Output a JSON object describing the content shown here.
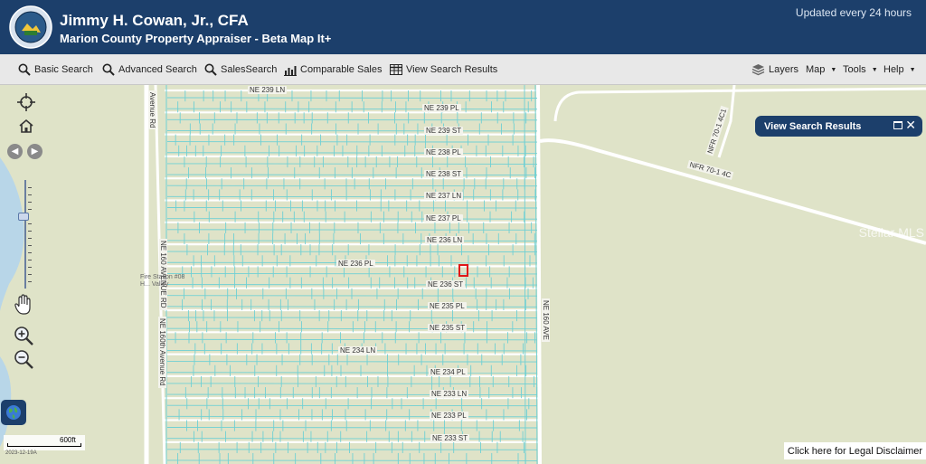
{
  "header": {
    "name": "Jimmy H. Cowan, Jr., CFA",
    "subtitle": "Marion County Property Appraiser - Beta Map It+",
    "updated": "Updated every 24 hours"
  },
  "toolbar": {
    "basic_search": "Basic Search",
    "advanced_search": "Advanced Search",
    "sales_search": "SalesSearch",
    "comparable_sales": "Comparable Sales",
    "view_search_results": "View Search Results",
    "layers": "Layers",
    "map": "Map",
    "tools": "Tools",
    "help": "Help"
  },
  "panel": {
    "title": "View Search Results"
  },
  "streets": {
    "ne239ln": "NE 239 LN",
    "ne239pl": "NE 239 PL",
    "ne239st": "NE 239 ST",
    "ne238pl": "NE 238 PL",
    "ne238st": "NE 238 ST",
    "ne237ln": "NE 237 LN",
    "ne237pl": "NE 237 PL",
    "ne236ln": "NE 236 LN",
    "ne236pl": "NE 236 PL",
    "ne236st": "NE 236 ST",
    "ne235pl": "NE 235 PL",
    "ne235st": "NE 235 ST",
    "ne234ln": "NE 234 LN",
    "ne234pl": "NE 234 PL",
    "ne233ln": "NE 233 LN",
    "ne233pl": "NE 233 PL",
    "ne233st": "NE 233 ST",
    "avenue_rd": "Avenue Rd",
    "ne160_avenue_rd": "NE 160 AVENUE RD",
    "ne160th_avenue_rd": "NE 160th Avenue Rd",
    "ne160_ave": "NE 160 AVE",
    "nfr70_1_4c": "NFR 70-1 4C",
    "nfr70_1_4c1": "NFR 70-1 4C1"
  },
  "map": {
    "fire_station": "Fire Station #08\nH... Valley",
    "watermark": "Stellar MLS",
    "scale": "600ft",
    "build_date": "2023-12-19A",
    "disclaimer": "Click here for Legal Disclaimer"
  },
  "colors": {
    "header_bg": "#1c3f6b",
    "parcel_lines": "#6fd0d4",
    "selected_parcel": "#e01818",
    "map_bg": "#dfe3c8"
  },
  "icons": [
    "seal-logo",
    "search-icon",
    "chart-icon",
    "table-icon",
    "layers-icon",
    "locate-icon",
    "home-icon",
    "pan-hand-icon",
    "zoom-in-icon",
    "zoom-out-icon",
    "globe-icon"
  ]
}
